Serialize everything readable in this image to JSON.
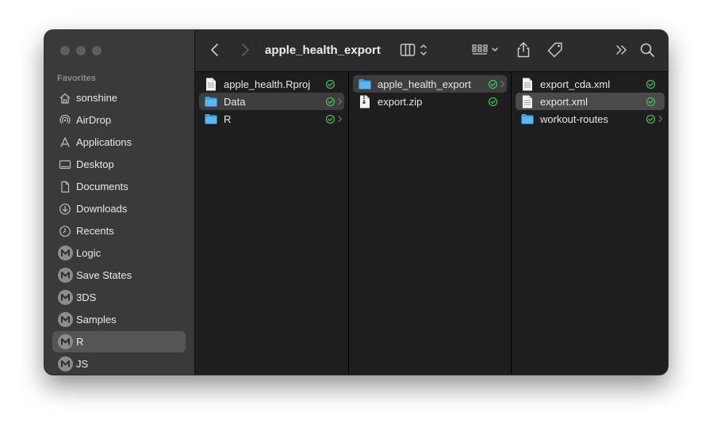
{
  "window": {
    "title": "apple_health_export"
  },
  "sidebar": {
    "section": "Favorites",
    "items": [
      {
        "label": "sonshine",
        "icon": "home-icon"
      },
      {
        "label": "AirDrop",
        "icon": "airdrop-icon"
      },
      {
        "label": "Applications",
        "icon": "applications-icon"
      },
      {
        "label": "Desktop",
        "icon": "desktop-icon"
      },
      {
        "label": "Documents",
        "icon": "document-icon"
      },
      {
        "label": "Downloads",
        "icon": "downloads-icon"
      },
      {
        "label": "Recents",
        "icon": "clock-icon"
      },
      {
        "label": "Logic",
        "icon": "m-drive-icon"
      },
      {
        "label": "Save States",
        "icon": "m-drive-icon"
      },
      {
        "label": "3DS",
        "icon": "m-drive-icon"
      },
      {
        "label": "Samples",
        "icon": "m-drive-icon"
      },
      {
        "label": "R",
        "icon": "m-drive-icon",
        "selected": true
      },
      {
        "label": "JS",
        "icon": "m-drive-icon"
      }
    ]
  },
  "columns": [
    [
      {
        "name": "apple_health.Rproj",
        "type": "file"
      },
      {
        "name": "Data",
        "type": "folder",
        "selected": true,
        "chevron": true
      },
      {
        "name": "R",
        "type": "folder",
        "chevron": true
      }
    ],
    [
      {
        "name": "apple_health_export",
        "type": "folder",
        "selected": true,
        "chevron": true
      },
      {
        "name": "export.zip",
        "type": "zip"
      }
    ],
    [
      {
        "name": "export_cda.xml",
        "type": "file"
      },
      {
        "name": "export.xml",
        "type": "file",
        "selected": true
      },
      {
        "name": "workout-routes",
        "type": "folder",
        "chevron": true
      }
    ]
  ],
  "colors": {
    "sync": "#34c759",
    "folder": "#4fb2f4",
    "sidebar": "#3a3a3a",
    "content": "#1e1e1e"
  }
}
